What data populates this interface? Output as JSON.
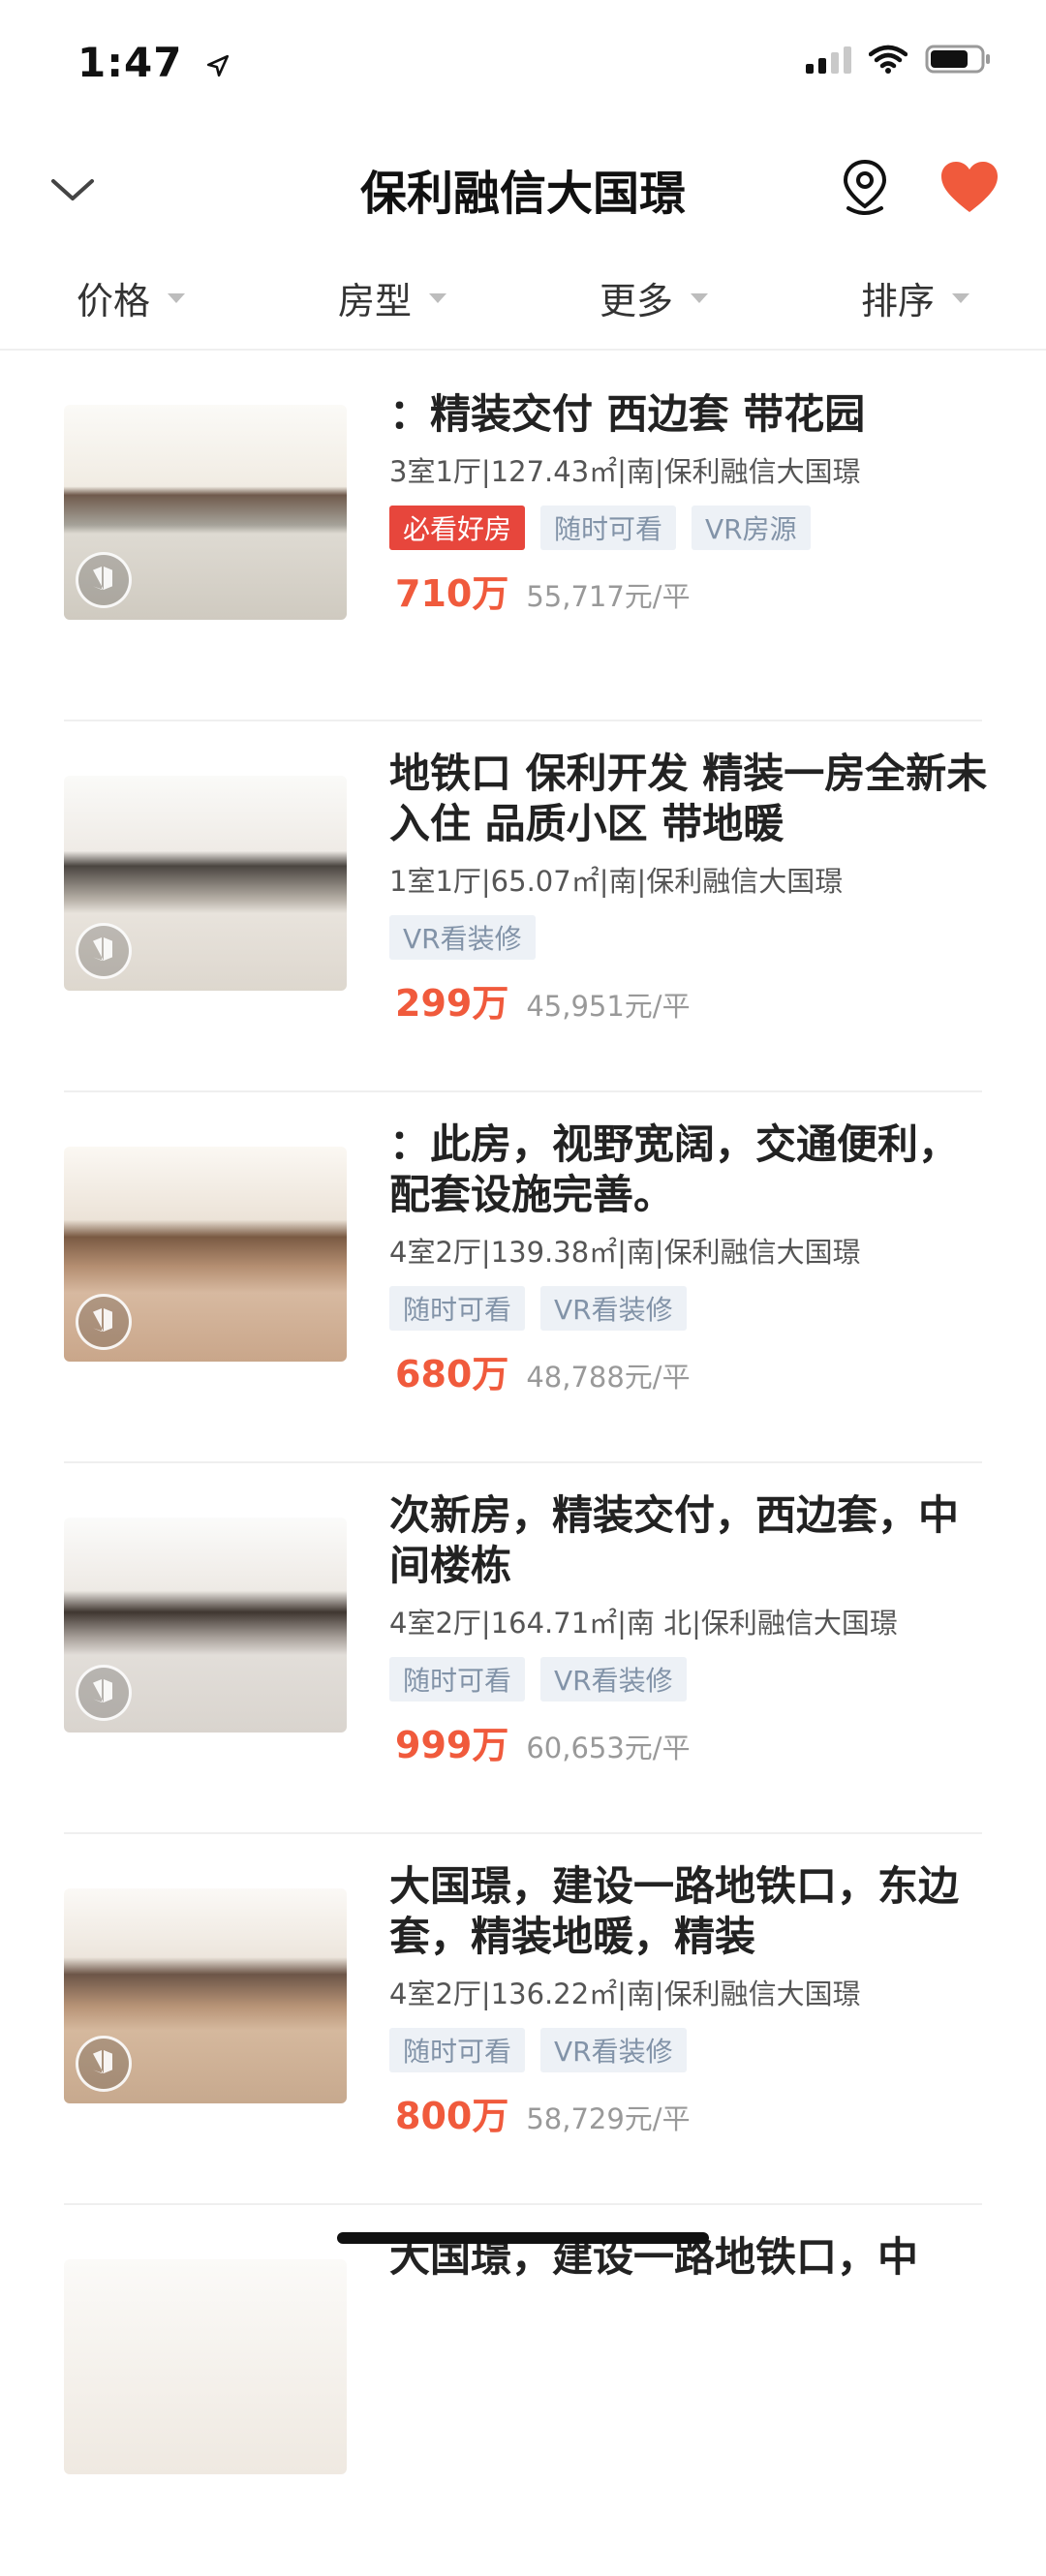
{
  "status_bar": {
    "time": "1:47"
  },
  "nav": {
    "title": "保利融信大国璟"
  },
  "filters": [
    {
      "label": "价格"
    },
    {
      "label": "房型"
    },
    {
      "label": "更多"
    },
    {
      "label": "排序"
    }
  ],
  "listings": [
    {
      "title": "：精装交付  西边套  带花园",
      "meta": "3室1厅|127.43㎡|南|保利融信大国璟",
      "tags": [
        "必看好房",
        "随时可看",
        "VR房源"
      ],
      "price": "710万",
      "unit_price": "55,717元/平"
    },
    {
      "title": "地铁口 保利开发 精装一房全新未入住 品质小区 带地暖",
      "meta": "1室1厅|65.07㎡|南|保利融信大国璟",
      "tags": [
        "VR看装修"
      ],
      "price": "299万",
      "unit_price": "45,951元/平"
    },
    {
      "title": "：此房，视野宽阔，交通便利，配套设施完善。",
      "meta": "4室2厅|139.38㎡|南|保利融信大国璟",
      "tags": [
        "随时可看",
        "VR看装修"
      ],
      "price": "680万",
      "unit_price": "48,788元/平"
    },
    {
      "title": "次新房，精装交付，西边套，中间楼栋",
      "meta": "4室2厅|164.71㎡|南 北|保利融信大国璟",
      "tags": [
        "随时可看",
        "VR看装修"
      ],
      "price": "999万",
      "unit_price": "60,653元/平"
    },
    {
      "title": "大国璟，建设一路地铁口，东边套，精装地暖，精装",
      "meta": "4室2厅|136.22㎡|南|保利融信大国璟",
      "tags": [
        "随时可看",
        "VR看装修"
      ],
      "price": "800万",
      "unit_price": "58,729元/平"
    },
    {
      "title": "大国璟，建设一路地铁口，中",
      "meta": "",
      "tags": [],
      "price": "",
      "unit_price": ""
    }
  ],
  "colors": {
    "accent": "#f05a3c",
    "hot_tag": "#e7463c",
    "tag_bg": "#edf1f6",
    "tag_text": "#8293a8"
  }
}
